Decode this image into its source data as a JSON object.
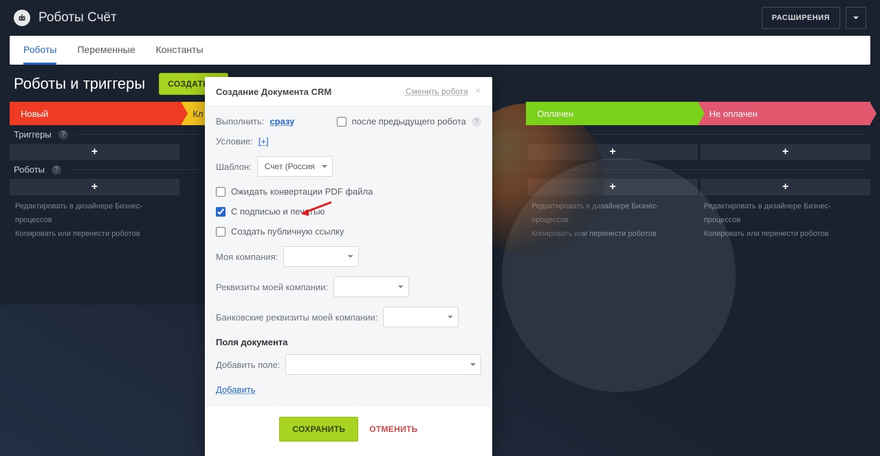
{
  "header": {
    "title": "Роботы Счёт",
    "extensions_btn": "РАСШИРЕНИЯ"
  },
  "tabs": [
    {
      "label": "Роботы",
      "active": true
    },
    {
      "label": "Переменные",
      "active": false
    },
    {
      "label": "Константы",
      "active": false
    }
  ],
  "page": {
    "title": "Роботы и триггеры",
    "create_btn": "СОЗДАТЬ"
  },
  "stages": [
    "Новый",
    "Кл",
    "",
    "Оплачен",
    "Не оплачен"
  ],
  "sections": {
    "triggers": "Триггеры",
    "robots": "Роботы"
  },
  "row_links": {
    "edit_designer": "Редактировать в дизайнере Бизнес-процессов",
    "copy_move": "Копировать или перенести роботов"
  },
  "modal": {
    "title": "Создание Документа CRM",
    "change_robot": "Сменить робота",
    "execute_label": "Выполнить:",
    "execute_value": "сразу",
    "after_prev": "после предыдущего робота",
    "condition_label": "Условие:",
    "condition_value": "[+]",
    "template_label": "Шаблон:",
    "template_value": "Счет (Россия)",
    "wait_pdf": "Ожидать конвертации PDF файла",
    "with_sign": "С подписью и печатью",
    "create_public": "Создать публичную ссылку",
    "my_company": "Моя компания:",
    "my_company_req": "Реквизиты моей компании:",
    "my_company_bank": "Банковские реквизиты моей компании:",
    "doc_fields_title": "Поля документа",
    "add_field_label": "Добавить поле:",
    "add_link": "Добавить",
    "save_btn": "СОХРАНИТЬ",
    "cancel_btn": "ОТМЕНИТЬ"
  }
}
